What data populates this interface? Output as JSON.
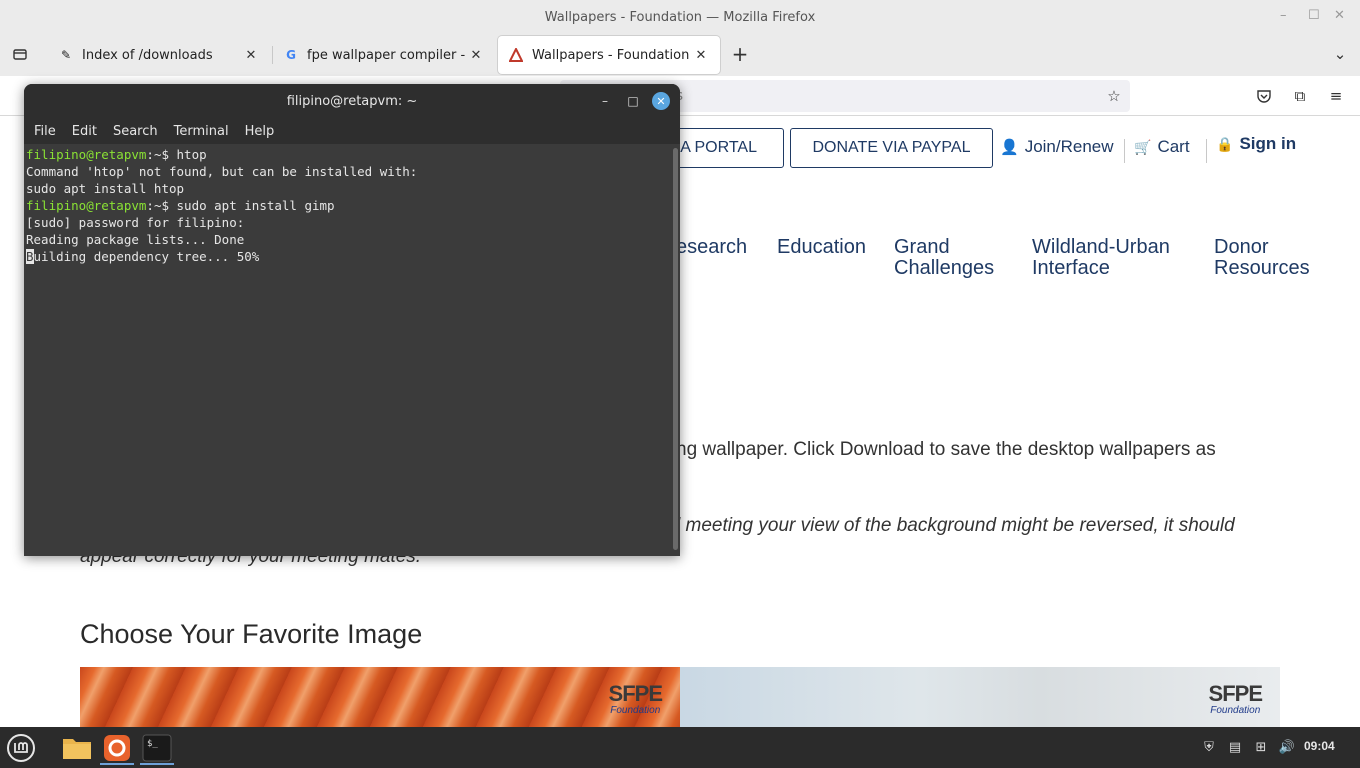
{
  "firefox": {
    "window_title": "Wallpapers - Foundation — Mozilla Firefox",
    "tabs": [
      {
        "title": "Index of /downloads"
      },
      {
        "title": "fpe wallpaper compiler - Go"
      },
      {
        "title": "Wallpapers - Foundation"
      }
    ],
    "url_partial": "rs"
  },
  "site": {
    "buttons": {
      "portal": "VIA PORTAL",
      "paypal": "DONATE VIA PAYPAL"
    },
    "utility_links": {
      "join": "Join/Renew",
      "cart": "Cart",
      "signin": "Sign in"
    },
    "nav": {
      "research": "esearch",
      "education": "Education",
      "grand_challenges_1": "Grand",
      "grand_challenges_2": "Challenges",
      "wui_1": "Wildland-Urban",
      "wui_2": "Interface",
      "donor_1": "Donor",
      "donor_2": "Resources"
    },
    "intro_text": "ng wallpaper. Click Download to save the desktop wallpapers as",
    "note_line1": "l meeting your view of the background might be reversed, it should",
    "note_line2": "appear correctly for your meeting mates.",
    "section_heading": "Choose Your Favorite Image",
    "logo_word": "SFPE",
    "logo_sub": "Foundation"
  },
  "terminal": {
    "title": "filipino@retapvm: ~",
    "menu": [
      "File",
      "Edit",
      "Search",
      "Terminal",
      "Help"
    ],
    "prompt_user": "filipino@retapvm",
    "prompt_path": ":~$ ",
    "lines": {
      "cmd1": "htop",
      "out1": "Command 'htop' not found, but can be installed with:",
      "out2": "sudo apt install htop",
      "cmd2": "sudo apt install gimp",
      "out3": "[sudo] password for filipino:",
      "out4": "Reading package lists... Done",
      "out5_cursor": "B",
      "out5_rest": "uilding dependency tree... 50%"
    }
  },
  "taskbar": {
    "clock": "09:04"
  },
  "colors": {
    "brand_navy": "#1f3a64",
    "prompt_green": "#8ae234",
    "terminal_bg": "#3b3b3b"
  }
}
